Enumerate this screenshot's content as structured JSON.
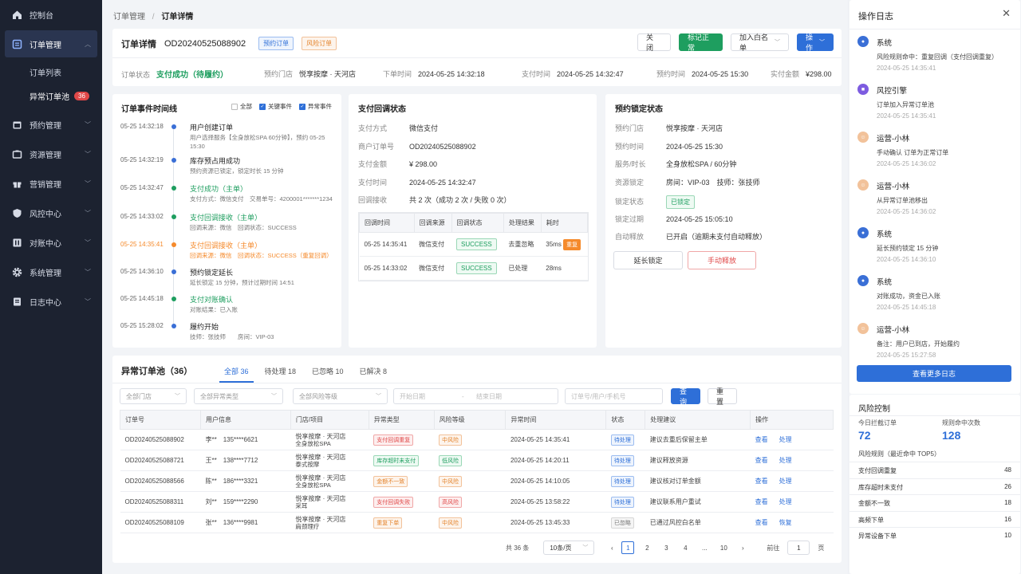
{
  "sidebar": {
    "items": [
      {
        "label": "控制台",
        "icon": "home-icon"
      },
      {
        "label": "订单管理",
        "icon": "order-icon",
        "active": true
      },
      {
        "label": "预约管理",
        "icon": "calendar-icon"
      },
      {
        "label": "资源管理",
        "icon": "resource-icon"
      },
      {
        "label": "营销管理",
        "icon": "gift-icon"
      },
      {
        "label": "风控中心",
        "icon": "shield-icon"
      },
      {
        "label": "对账中心",
        "icon": "ledger-icon"
      },
      {
        "label": "系统管理",
        "icon": "gear-icon"
      },
      {
        "label": "日志中心",
        "icon": "log-icon"
      }
    ],
    "sub_items": [
      {
        "label": "订单列表"
      },
      {
        "label": "异常订单池",
        "badge": "36"
      }
    ]
  },
  "breadcrumb": {
    "parent": "订单管理",
    "sep": "/",
    "current": "订单详情"
  },
  "header": {
    "title": "订单详情",
    "order_no": "OD20240525088902",
    "tags": [
      "预约订单",
      "风险订单"
    ],
    "buttons": {
      "close": "关 闭",
      "mark": "标记正常",
      "whitelist": "加入白名单",
      "ops": "操作"
    }
  },
  "summary": {
    "status_k": "订单状态",
    "status_v": "支付成功（待履约）",
    "store_k": "预约门店",
    "store_v": "悦享按摩 · 天河店",
    "order_time_k": "下单时间",
    "order_time_v": "2024-05-25  14:32:18",
    "pay_time_k": "支付时间",
    "pay_time_v": "2024-05-25  14:32:47",
    "appt_time_k": "预约时间",
    "appt_time_v": "2024-05-25  15:30",
    "amount_k": "实付金额",
    "amount_v": "¥298.00"
  },
  "timeline": {
    "title": "订单事件时间线",
    "filters": [
      {
        "label": "全部",
        "checked": false
      },
      {
        "label": "关键事件",
        "checked": true
      },
      {
        "label": "异常事件",
        "checked": true
      }
    ],
    "events": [
      {
        "time": "05-25 14:32:18",
        "title": "用户创建订单",
        "desc": "用户选择服务【全身放松SPA 60分钟】，预约 05-25 15:30",
        "color": "#3a6fd6",
        "time_color": "#666",
        "title_color": "#222"
      },
      {
        "time": "05-25 14:32:19",
        "title": "库存预占用成功",
        "desc": "预约资源已锁定，锁定时长 15 分钟",
        "color": "#3a6fd6",
        "time_color": "#666",
        "title_color": "#222"
      },
      {
        "time": "05-25 14:32:47",
        "title": "支付成功（主单）",
        "desc": "支付方式：微信支付　交易单号：4200001*******1234",
        "color": "#1e9e5f",
        "time_color": "#666",
        "title_color": "#1e9e5f"
      },
      {
        "time": "05-25 14:33:02",
        "title": "支付回调接收（主单）",
        "desc": "回调来源：微信　回调状态：SUCCESS",
        "color": "#1e9e5f",
        "time_color": "#666",
        "title_color": "#1e9e5f"
      },
      {
        "time": "05-25 14:35:41",
        "title": "支付回调接收（主单）",
        "desc": "回调来源：微信　回调状态：SUCCESS（重复回调）",
        "color": "#f58a2b",
        "time_color": "#f58a2b",
        "title_color": "#f58a2b"
      },
      {
        "time": "05-25 14:36:10",
        "title": "预约锁定延长",
        "desc": "延长锁定 15 分钟，预计过期时间 14:51",
        "color": "#3a6fd6",
        "time_color": "#666",
        "title_color": "#222"
      },
      {
        "time": "05-25 14:45:18",
        "title": "支付对账确认",
        "desc": "对账结果：已入账",
        "color": "#1e9e5f",
        "time_color": "#666",
        "title_color": "#1e9e5f"
      },
      {
        "time": "05-25 15:28:02",
        "title": "履约开始",
        "desc": "技师：张技师　　房间：VIP-03",
        "color": "#3a6fd6",
        "time_color": "#666",
        "title_color": "#222"
      }
    ]
  },
  "callback": {
    "title": "支付回调状态",
    "fields": [
      {
        "k": "支付方式",
        "v": "微信支付"
      },
      {
        "k": "商户订单号",
        "v": "OD20240525088902"
      },
      {
        "k": "支付金额",
        "v": "¥ 298.00"
      },
      {
        "k": "支付时间",
        "v": "2024-05-25  14:32:47"
      },
      {
        "k": "回调接收",
        "v": "共 2 次（成功 2 次 / 失败 0 次）"
      }
    ],
    "table_headers": [
      "回调时间",
      "回调来源",
      "回调状态",
      "处理结果",
      "耗时"
    ],
    "rows": [
      {
        "time": "05-25 14:35:41",
        "src": "微信支付",
        "status": "SUCCESS",
        "result": "去重忽略",
        "cost": "35ms",
        "flag": "重复"
      },
      {
        "time": "05-25 14:33:02",
        "src": "微信支付",
        "status": "SUCCESS",
        "result": "已处理",
        "cost": "28ms",
        "flag": ""
      }
    ]
  },
  "lock": {
    "title": "预约锁定状态",
    "fields": [
      {
        "k": "预约门店",
        "v": "悦享按摩 · 天河店"
      },
      {
        "k": "预约时间",
        "v": "2024-05-25  15:30"
      },
      {
        "k": "服务/时长",
        "v": "全身放松SPA / 60分钟"
      },
      {
        "k": "资源锁定",
        "v": "房间：VIP-03　技师：张技师"
      },
      {
        "k": "锁定状态",
        "v": "已锁定"
      },
      {
        "k": "锁定过期",
        "v": "2024-05-25  15:05:10"
      },
      {
        "k": "自动释放",
        "v": "已开启（逾期未支付自动释放）"
      }
    ],
    "btn_extend": "延长锁定",
    "btn_release": "手动释放"
  },
  "pool": {
    "title": "异常订单池（36）",
    "tabs": [
      {
        "label": "全部 36",
        "active": true
      },
      {
        "label": "待处理 18"
      },
      {
        "label": "已忽略 10"
      },
      {
        "label": "已解决 8"
      }
    ],
    "filters": {
      "store": "全部门店",
      "type": "全部异常类型",
      "risk": "全部风险等级",
      "start": "开始日期",
      "sep": "-",
      "end": "结束日期",
      "keyword": "订单号/用户/手机号",
      "search": "查询",
      "reset": "重置"
    },
    "headers": [
      "订单号",
      "用户信息",
      "门店/项目",
      "异常类型",
      "风险等级",
      "异常时间",
      "状态",
      "处理建议",
      "操作"
    ],
    "rows": [
      {
        "no": "OD20240525088902",
        "user": "李**　135****6621",
        "store1": "悦享按摩 · 天河店",
        "store2": "全身放松SPA",
        "type": "支付回调重复",
        "type_cls": "red",
        "risk": "中风险",
        "risk_cls": "orange",
        "time": "2024-05-25  14:35:41",
        "status": "待处理",
        "status_cls": "blue",
        "advice": "建议去重后保留主单",
        "op1": "查看",
        "op2": "处理"
      },
      {
        "no": "OD20240525088721",
        "user": "王**　138****7712",
        "store1": "悦享按摩 · 天河店",
        "store2": "泰式按摩",
        "type": "库存超时未支付",
        "type_cls": "green",
        "risk": "低风险",
        "risk_cls": "green",
        "time": "2024-05-25  14:20:11",
        "status": "待处理",
        "status_cls": "blue",
        "advice": "建议释放资源",
        "op1": "查看",
        "op2": "处理"
      },
      {
        "no": "OD20240525088566",
        "user": "陈**　186****3321",
        "store1": "悦享按摩 · 天河店",
        "store2": "全身放松SPA",
        "type": "金额不一致",
        "type_cls": "orange",
        "risk": "中风险",
        "risk_cls": "orange",
        "time": "2024-05-25  14:10:05",
        "status": "待处理",
        "status_cls": "blue",
        "advice": "建议核对订单金额",
        "op1": "查看",
        "op2": "处理"
      },
      {
        "no": "OD20240525088311",
        "user": "刘**　159****2290",
        "store1": "悦享按摩 · 天河店",
        "store2": "采耳",
        "type": "支付回调失败",
        "type_cls": "red",
        "risk": "高风险",
        "risk_cls": "red",
        "time": "2024-05-25  13:58:22",
        "status": "待处理",
        "status_cls": "blue",
        "advice": "建议联系用户重试",
        "op1": "查看",
        "op2": "处理"
      },
      {
        "no": "OD20240525088109",
        "user": "张**　136****9981",
        "store1": "悦享按摩 · 天河店",
        "store2": "肩颈理疗",
        "type": "重复下单",
        "type_cls": "orange",
        "risk": "中风险",
        "risk_cls": "orange",
        "time": "2024-05-25  13:45:33",
        "status": "已忽略",
        "status_cls": "gray",
        "advice": "已通过风控白名单",
        "op1": "查看",
        "op2": "恢复"
      }
    ],
    "pagination": {
      "total": "共 36 条",
      "size": "10条/页",
      "pages": [
        "1",
        "2",
        "3",
        "4",
        "...",
        "10"
      ],
      "goto": "前往",
      "goto_val": "1",
      "page_unit": "页"
    }
  },
  "log": {
    "title": "操作日志",
    "items": [
      {
        "name": "系统",
        "text": "风险规则命中：重复回调（支付回调重复）",
        "time": "2024-05-25 14:35:41",
        "av": "sys"
      },
      {
        "name": "风控引擎",
        "text": "订单加入异常订单池",
        "time": "2024-05-25 14:35:41",
        "av": "risk"
      },
      {
        "name": "运营-小林",
        "text": "手动确认 订单为正常订单",
        "time": "2024-05-25 14:36:02",
        "av": "user"
      },
      {
        "name": "运营-小林",
        "text": "从异常订单池移出",
        "time": "2024-05-25 14:36:02",
        "av": "user"
      },
      {
        "name": "系统",
        "text": "延长预约锁定 15 分钟",
        "time": "2024-05-25 14:36:10",
        "av": "sys"
      },
      {
        "name": "系统",
        "text": "对账成功，资金已入账",
        "time": "2024-05-25 14:45:18",
        "av": "sys"
      },
      {
        "name": "运营-小林",
        "text": "备注：用户已到店，开始履约",
        "time": "2024-05-25 15:27:58",
        "av": "user"
      }
    ],
    "more": "查看更多日志"
  },
  "risk": {
    "title": "风险控制",
    "stat1_label": "今日拦截订单",
    "stat1_value": "72",
    "stat2_label": "规则命中次数",
    "stat2_value": "128",
    "rules_title": "风险规则（最近命中 TOP5）",
    "rules": [
      {
        "name": "支付回调重复",
        "count": "48"
      },
      {
        "name": "库存超时未支付",
        "count": "26"
      },
      {
        "name": "金额不一致",
        "count": "18"
      },
      {
        "name": "高频下单",
        "count": "16"
      },
      {
        "name": "异常设备下单",
        "count": "10"
      }
    ]
  }
}
